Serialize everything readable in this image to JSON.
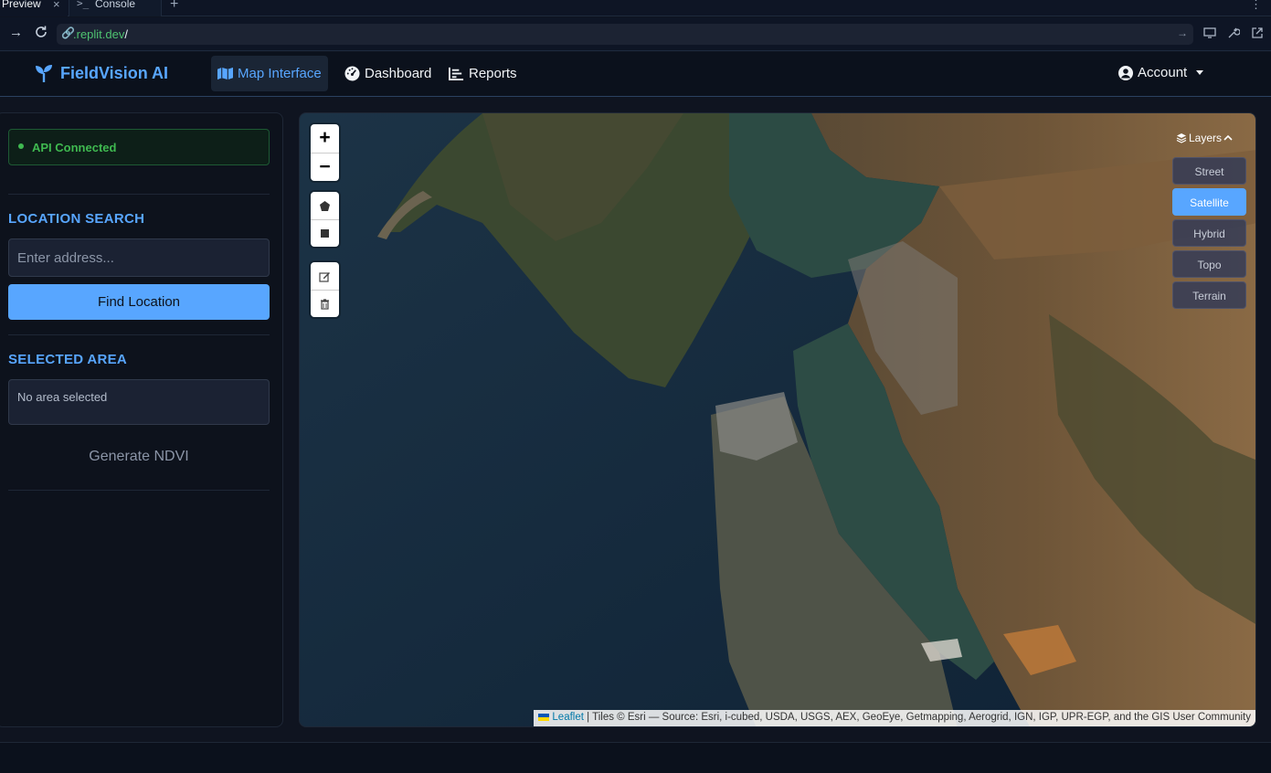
{
  "browser": {
    "tabs": [
      {
        "label": "Preview",
        "close": "×"
      },
      {
        "label": "Console",
        "icon": ">_"
      }
    ],
    "new_tab": "+",
    "menu": "⋮",
    "url_prefix": ".replit.dev",
    "url_suffix": "/"
  },
  "header": {
    "brand": "FieldVision AI",
    "nav": [
      {
        "label": "Map Interface",
        "icon": "map-icon",
        "active": true
      },
      {
        "label": "Dashboard",
        "icon": "dashboard-icon"
      },
      {
        "label": "Reports",
        "icon": "chart-icon"
      }
    ],
    "account": "Account"
  },
  "sidebar": {
    "status": "API Connected",
    "location_title": "LOCATION SEARCH",
    "address_placeholder": "Enter address...",
    "find_button": "Find Location",
    "area_title": "SELECTED AREA",
    "area_text": "No area selected",
    "ndvi_button": "Generate NDVI"
  },
  "map": {
    "zoom_in": "+",
    "zoom_out": "−",
    "layers_label": "Layers",
    "layers": [
      {
        "label": "Street",
        "active": false
      },
      {
        "label": "Satellite",
        "active": true
      },
      {
        "label": "Hybrid",
        "active": false
      },
      {
        "label": "Topo",
        "active": false
      },
      {
        "label": "Terrain",
        "active": false
      }
    ],
    "attribution_link": "Leaflet",
    "attribution_text": " | Tiles © Esri — Source: Esri, i-cubed, USDA, USGS, AEX, GeoEye, Getmapping, Aerogrid, IGN, IGP, UPR-EGP, and the GIS User Community"
  },
  "colors": {
    "accent": "#58a6ff",
    "status_green": "#3fb950",
    "background": "#0f1420"
  }
}
